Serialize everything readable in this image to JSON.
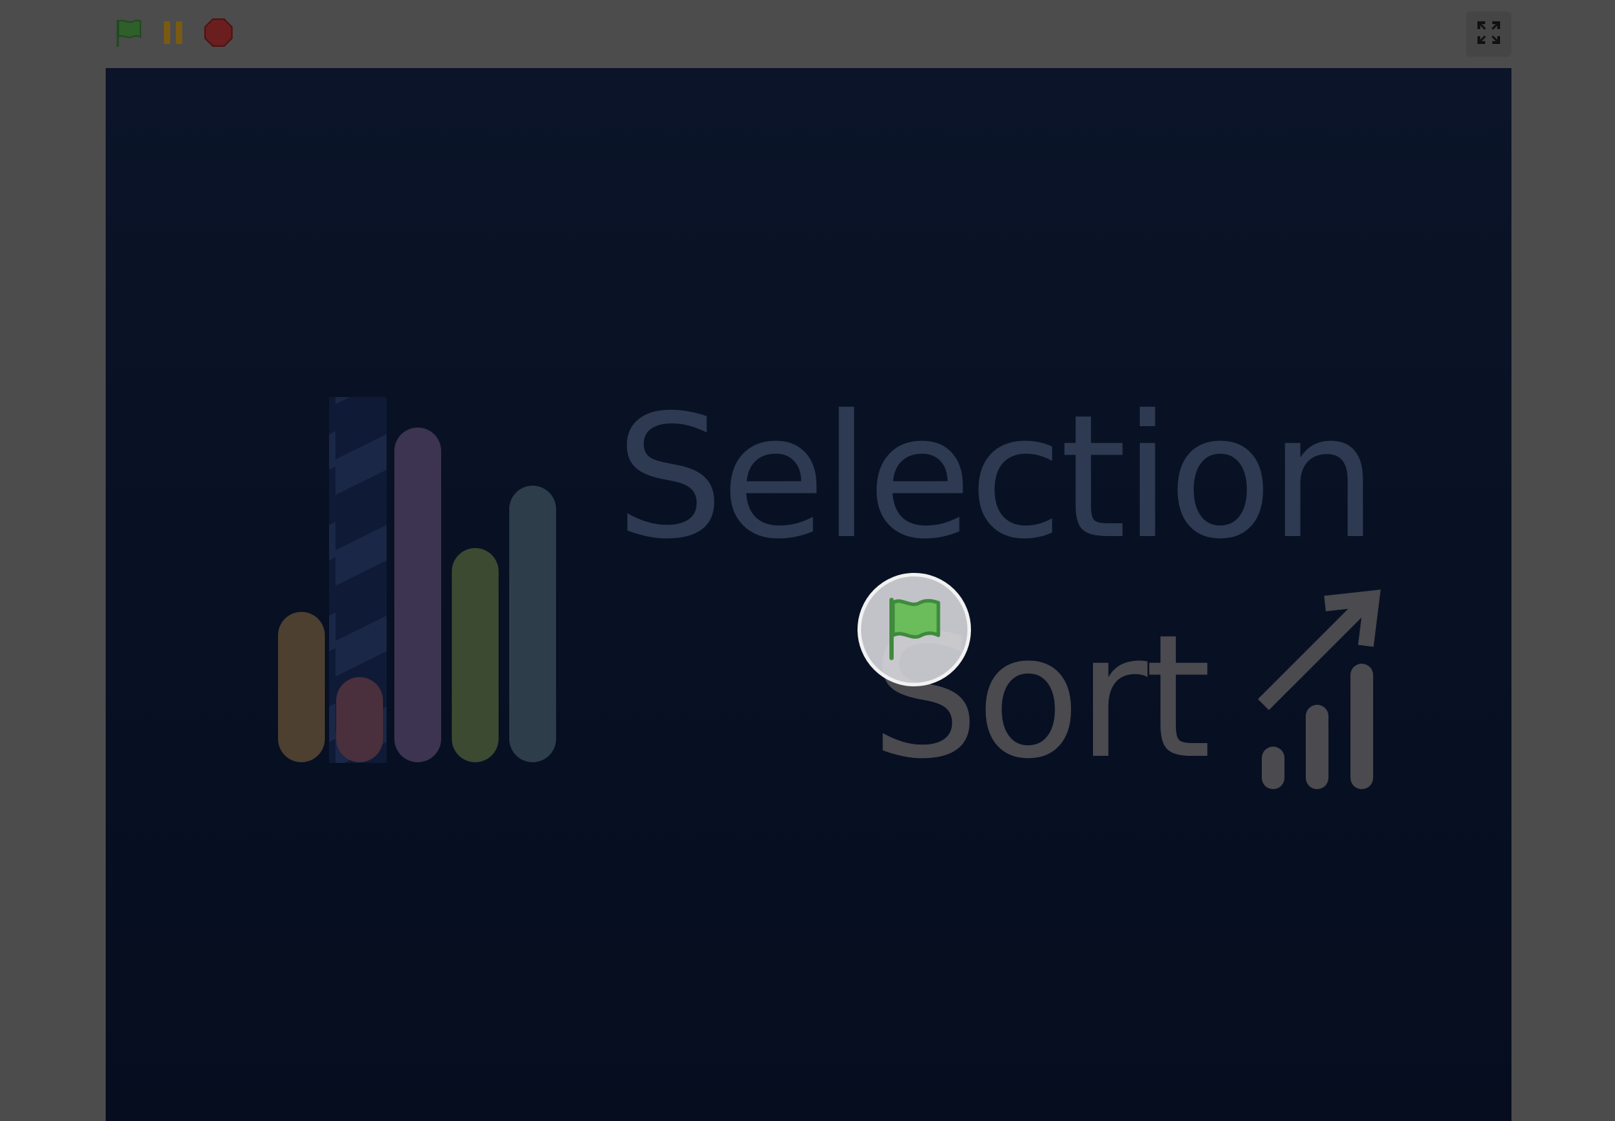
{
  "toolbar": {
    "green_flag_icon": "green-flag-icon",
    "pause_icon": "pause-icon",
    "stop_icon": "stop-icon",
    "fullscreen_icon": "fullscreen-icon"
  },
  "stage": {
    "title_line1": "Selection",
    "title_line2": "Sort",
    "background_color": "#050d1f",
    "bar_colors": [
      "#4d4030",
      "#4a2f3c",
      "#3c3450",
      "#3b4a31",
      "#2e3d4a"
    ],
    "play_overlay_icon": "green-flag-icon"
  },
  "colors": {
    "frame_background": "#4c4c4c",
    "flag_green": "#4f9a4b",
    "pause_orange": "#b8860b",
    "stop_red": "#7a2020"
  }
}
